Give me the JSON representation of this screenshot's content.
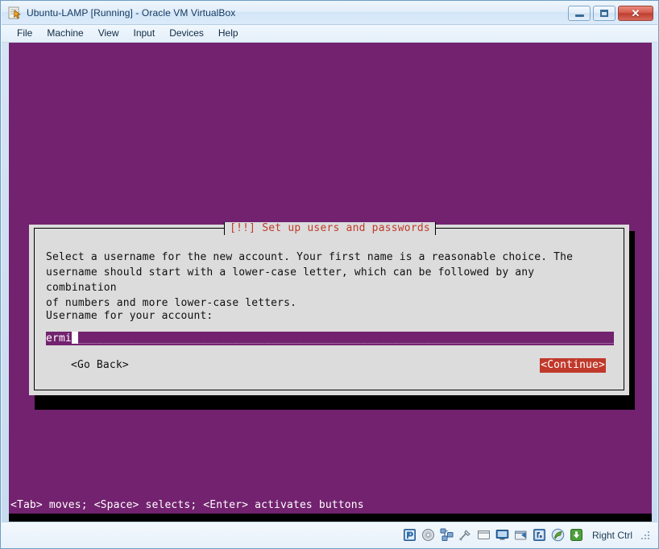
{
  "window": {
    "title": "Ubuntu-LAMP [Running] - Oracle VM VirtualBox",
    "icon": "virtualbox-vm-icon",
    "controls": {
      "minimize_label": "–",
      "maximize_label": "□",
      "close_label": "✕"
    }
  },
  "menubar": {
    "items": [
      {
        "label": "File",
        "name": "menu-file"
      },
      {
        "label": "Machine",
        "name": "menu-machine"
      },
      {
        "label": "View",
        "name": "menu-view"
      },
      {
        "label": "Input",
        "name": "menu-input"
      },
      {
        "label": "Devices",
        "name": "menu-devices"
      },
      {
        "label": "Help",
        "name": "menu-help"
      }
    ]
  },
  "guest": {
    "background_color": "#72226f",
    "dialog": {
      "title": "[!!] Set up users and passwords",
      "title_color": "#c0392b",
      "background_color": "#dcdcdc",
      "body_text": "Select a username for the new account. Your first name is a reasonable choice. The\nusername should start with a lower-case letter, which can be followed by any combination\nof numbers and more lower-case letters.",
      "prompt_label": "Username for your account:",
      "input": {
        "value": "ermi",
        "fill": "______________________________________________________________________________________",
        "field_color": "#72226f",
        "text_color": "#ffffff",
        "cursor": "block"
      },
      "buttons": {
        "go_back": "<Go Back>",
        "continue": "<Continue>",
        "continue_focus_color": "#c0392b",
        "continue_focused": true
      }
    },
    "help_line": "<Tab> moves; <Space> selects; <Enter> activates buttons"
  },
  "statusbar": {
    "icons": [
      {
        "name": "hard-disk-icon",
        "title": "Hard Disks"
      },
      {
        "name": "optical-drive-icon",
        "title": "Optical Drives"
      },
      {
        "name": "network-icon",
        "title": "Network"
      },
      {
        "name": "usb-icon",
        "title": "USB Devices"
      },
      {
        "name": "shared-folders-icon",
        "title": "Shared Folders"
      },
      {
        "name": "display-icon",
        "title": "Display"
      },
      {
        "name": "video-capture-icon",
        "title": "Video Capture"
      },
      {
        "name": "remote-desktop-icon",
        "title": "Remote Desktop"
      },
      {
        "name": "guest-additions-icon",
        "title": "Guest Additions"
      },
      {
        "name": "mouse-integration-icon",
        "title": "Mouse Integration"
      }
    ],
    "host_key": "Right Ctrl"
  }
}
